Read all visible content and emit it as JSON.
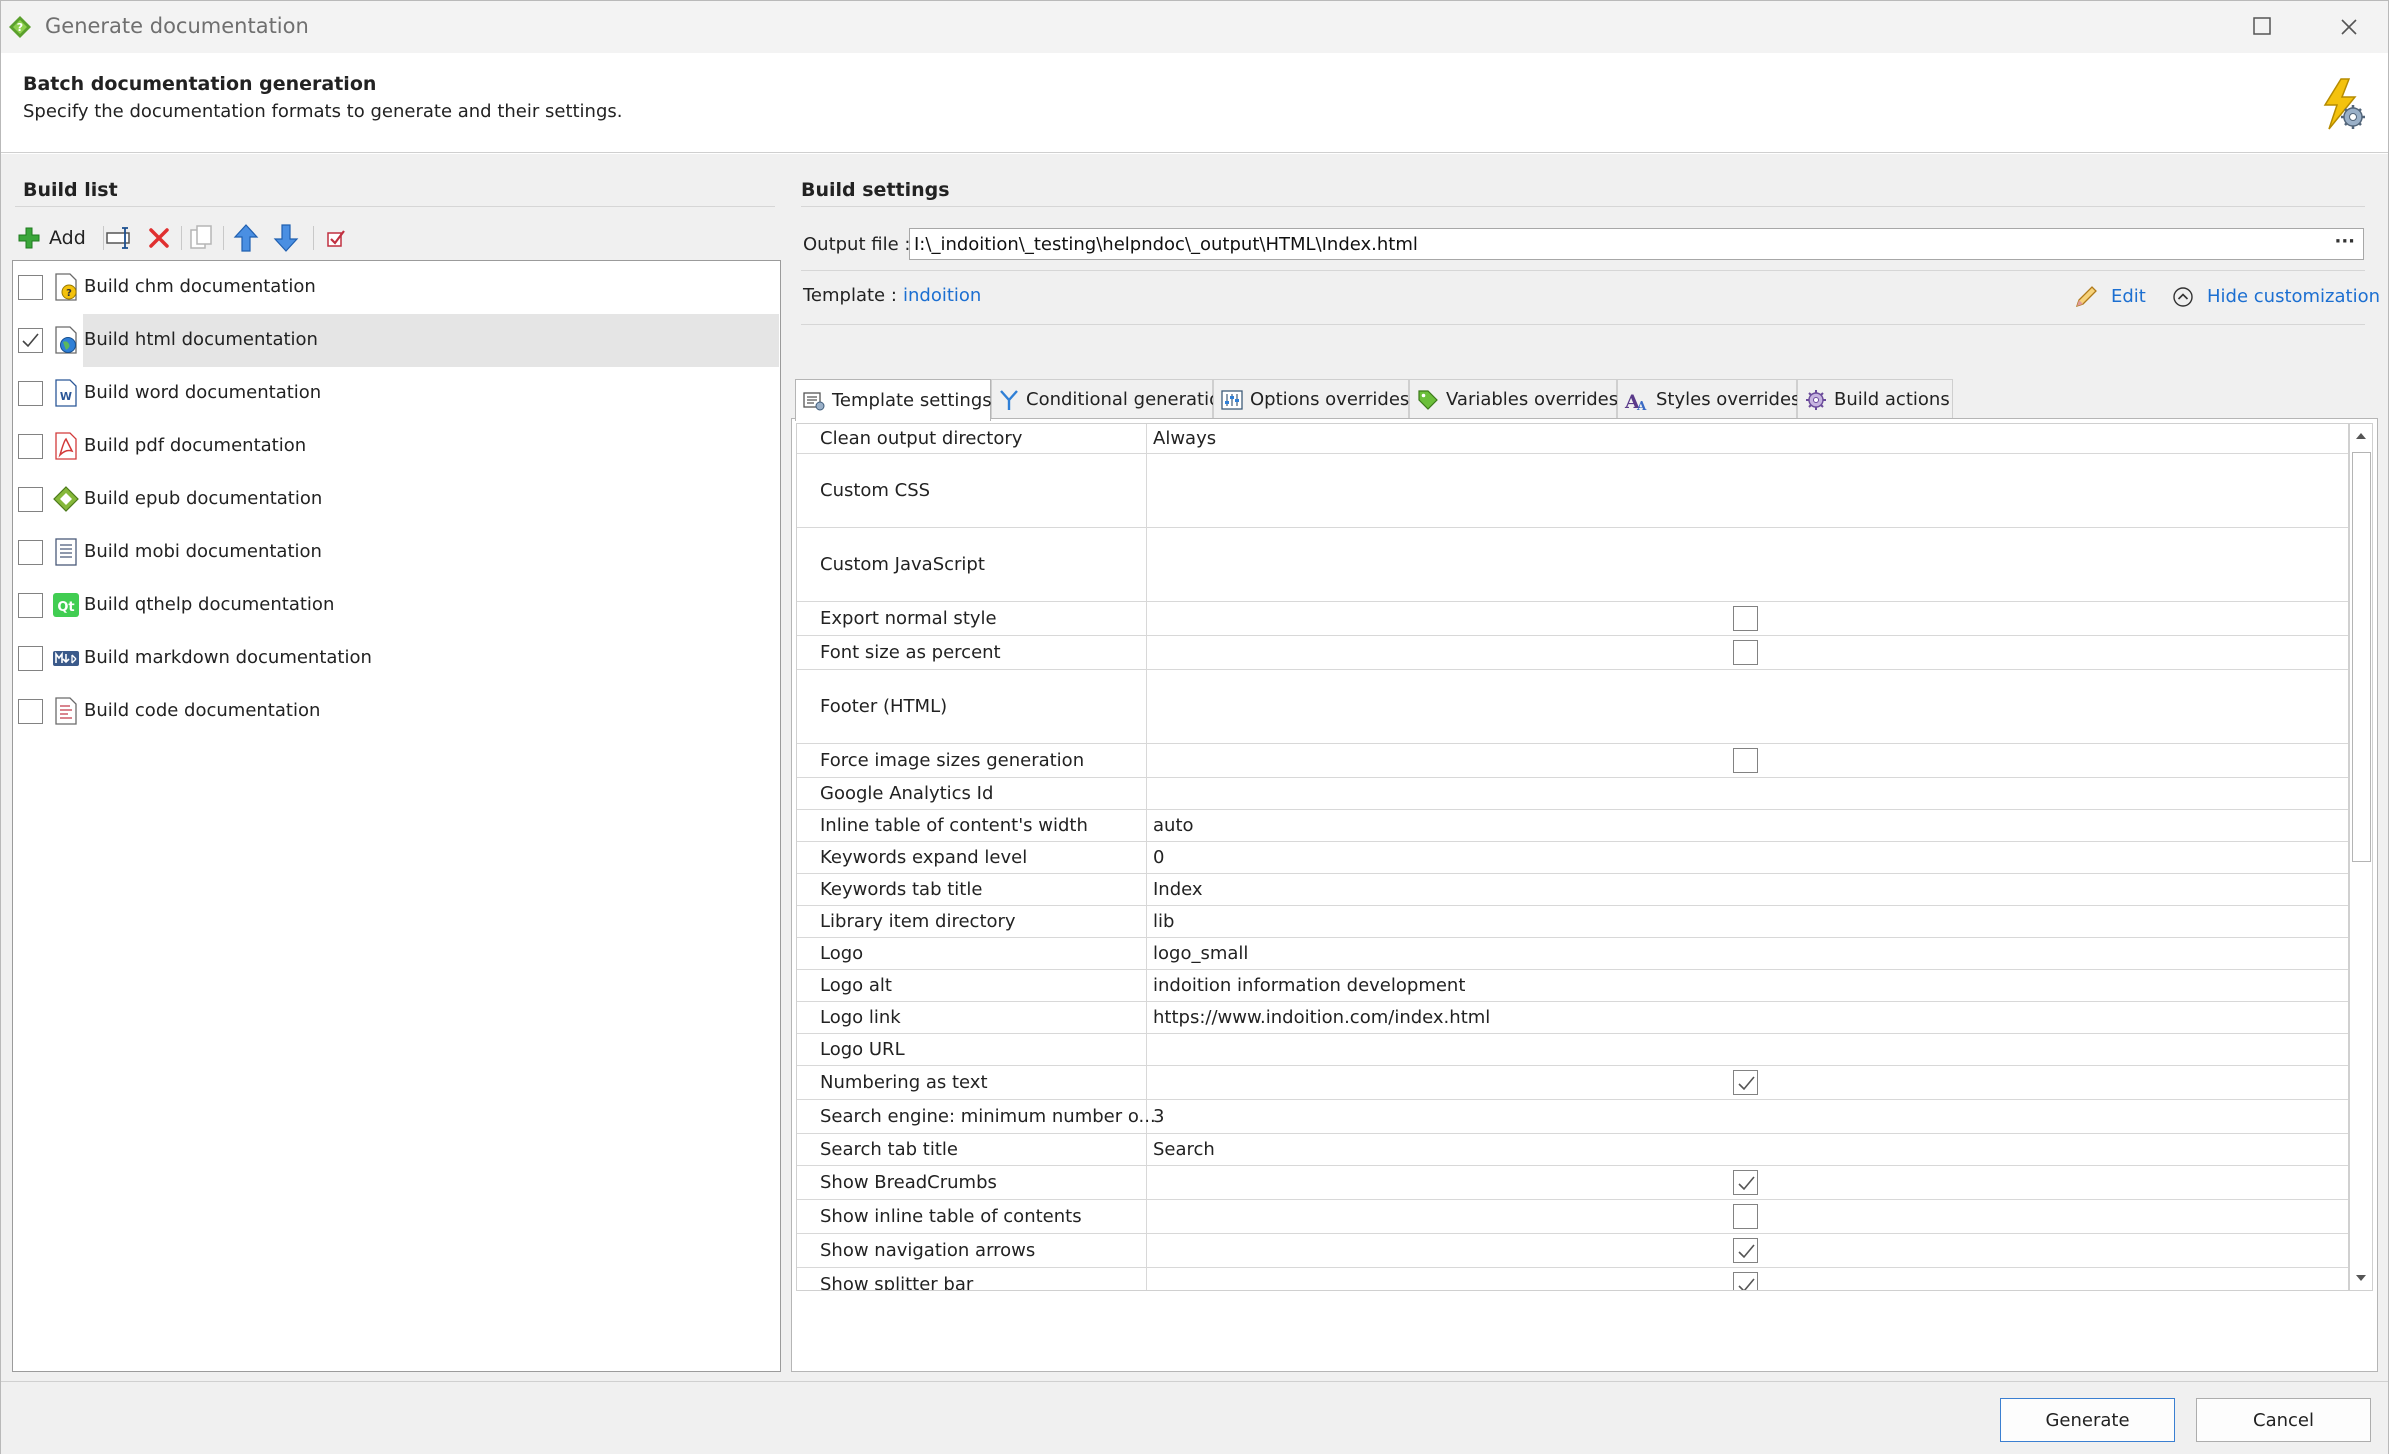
{
  "window": {
    "title": "Generate documentation"
  },
  "header": {
    "title": "Batch documentation generation",
    "subtitle": "Specify the documentation formats to generate and their settings."
  },
  "build_list": {
    "title": "Build list",
    "add_label": "Add",
    "items": [
      {
        "label": "Build chm documentation",
        "checked": false,
        "icon": "chm-help-icon"
      },
      {
        "label": "Build html documentation",
        "checked": true,
        "icon": "html-globe-icon"
      },
      {
        "label": "Build word documentation",
        "checked": false,
        "icon": "word-doc-icon"
      },
      {
        "label": "Build pdf documentation",
        "checked": false,
        "icon": "pdf-icon"
      },
      {
        "label": "Build epub documentation",
        "checked": false,
        "icon": "epub-icon"
      },
      {
        "label": "Build mobi documentation",
        "checked": false,
        "icon": "mobi-icon"
      },
      {
        "label": "Build qthelp documentation",
        "checked": false,
        "icon": "qt-icon"
      },
      {
        "label": "Build markdown documentation",
        "checked": false,
        "icon": "markdown-icon"
      },
      {
        "label": "Build code documentation",
        "checked": false,
        "icon": "code-doc-icon"
      }
    ]
  },
  "build_settings": {
    "title": "Build settings",
    "output_label": "Output file :",
    "output_value": "I:\\_indoition\\_testing\\helpndoc\\_output\\HTML\\Index.html",
    "output_browse": "···",
    "template_label": "Template :",
    "template_value": "indoition",
    "edit_label": "Edit",
    "hide_label": "Hide customization"
  },
  "tabs": [
    {
      "label": "Template settings",
      "icon": "template-settings-icon",
      "active": true
    },
    {
      "label": "Conditional generation",
      "icon": "conditional-branch-icon",
      "active": false
    },
    {
      "label": "Options overrides",
      "icon": "options-sliders-icon",
      "active": false
    },
    {
      "label": "Variables overrides",
      "icon": "variables-tag-icon",
      "active": false
    },
    {
      "label": "Styles overrides",
      "icon": "styles-font-icon",
      "active": false
    },
    {
      "label": "Build actions",
      "icon": "build-actions-gear-icon",
      "active": false
    }
  ],
  "settings_rows": [
    {
      "name": "Clean output directory",
      "value": "Always"
    },
    {
      "name": "Custom CSS",
      "value": ""
    },
    {
      "name": "Custom JavaScript",
      "value": ""
    },
    {
      "name": "Export normal style",
      "checkbox": false
    },
    {
      "name": "Font size as percent",
      "checkbox": false
    },
    {
      "name": "Footer (HTML)",
      "value": ""
    },
    {
      "name": "Force image sizes generation",
      "checkbox": false
    },
    {
      "name": "Google Analytics Id",
      "value": ""
    },
    {
      "name": "Inline table of content's width",
      "value": "auto"
    },
    {
      "name": "Keywords expand level",
      "value": "0"
    },
    {
      "name": "Keywords tab title",
      "value": "Index"
    },
    {
      "name": "Library item directory",
      "value": "lib"
    },
    {
      "name": "Logo",
      "value": "logo_small"
    },
    {
      "name": "Logo alt",
      "value": "indoition information development"
    },
    {
      "name": "Logo link",
      "value": "https://www.indoition.com/index.html"
    },
    {
      "name": "Logo URL",
      "value": ""
    },
    {
      "name": "Numbering as text",
      "checkbox": true
    },
    {
      "name": "Search engine: minimum number o...",
      "value": "3"
    },
    {
      "name": "Search tab title",
      "value": "Search"
    },
    {
      "name": "Show BreadCrumbs",
      "checkbox": true
    },
    {
      "name": "Show inline table of contents",
      "checkbox": false
    },
    {
      "name": "Show navigation arrows",
      "checkbox": true
    },
    {
      "name": "Show splitter bar",
      "checkbox": true
    }
  ],
  "footer": {
    "generate_label": "Generate",
    "cancel_label": "Cancel"
  },
  "colors": {
    "link": "#1c6fd1",
    "selected_row": "#e5e5e5",
    "accent_green": "#5aa02c"
  }
}
